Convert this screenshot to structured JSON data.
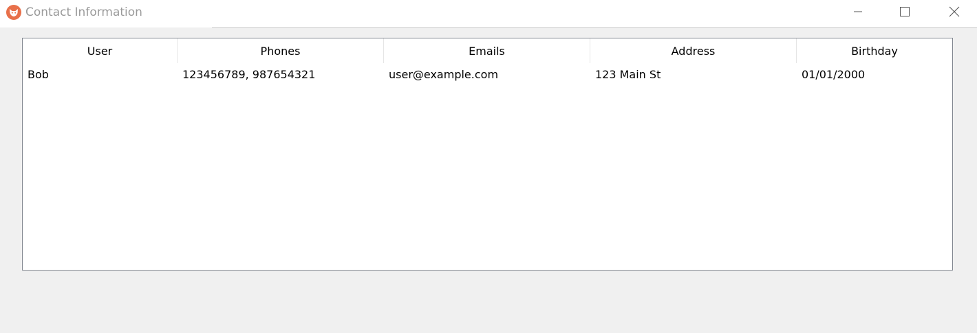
{
  "window": {
    "title": "Contact Information",
    "icon": "fox-app-icon",
    "accent_color": "#e8704a",
    "controls": {
      "minimize": "minimize-icon",
      "maximize": "maximize-icon",
      "close": "close-icon"
    }
  },
  "table": {
    "columns": [
      "User",
      "Phones",
      "Emails",
      "Address",
      "Birthday"
    ],
    "rows": [
      {
        "user": "Bob",
        "phones": "123456789, 987654321",
        "emails": "user@example.com",
        "address": "123 Main St",
        "birthday": "01/01/2000"
      }
    ]
  }
}
